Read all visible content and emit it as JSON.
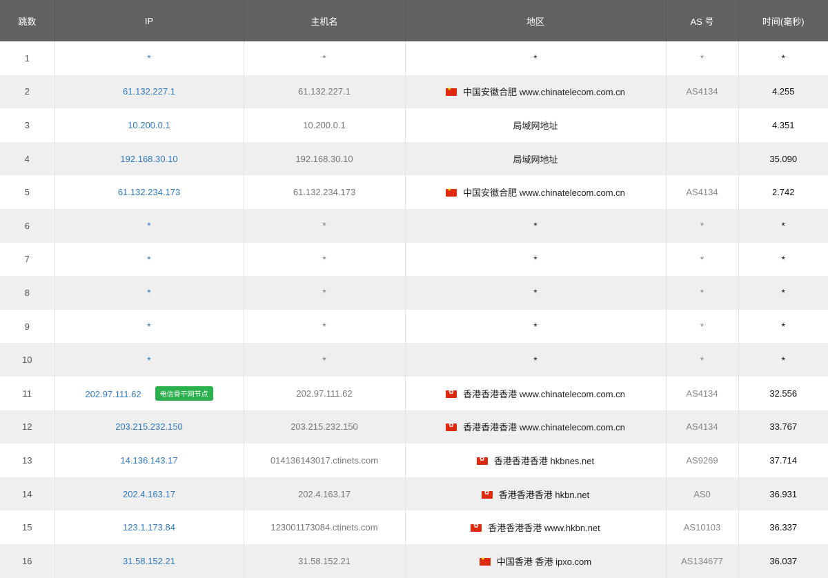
{
  "headers": [
    "跳数",
    "IP",
    "主机名",
    "地区",
    "AS 号",
    "时间(毫秒)"
  ],
  "rows": [
    {
      "hop": "1",
      "ip": "*",
      "host": "*",
      "region": "*",
      "flag": "",
      "asn": "*",
      "time": "*"
    },
    {
      "hop": "2",
      "ip": "61.132.227.1",
      "host": "61.132.227.1",
      "region": "中国安徽合肥 www.chinatelecom.com.cn",
      "flag": "cn-flag-icon",
      "asn": "AS4134",
      "time": "4.255"
    },
    {
      "hop": "3",
      "ip": "10.200.0.1",
      "host": "10.200.0.1",
      "region": "局域网地址",
      "flag": "",
      "asn": "",
      "time": "4.351"
    },
    {
      "hop": "4",
      "ip": "192.168.30.10",
      "host": "192.168.30.10",
      "region": "局域网地址",
      "flag": "",
      "asn": "",
      "time": "35.090"
    },
    {
      "hop": "5",
      "ip": "61.132.234.173",
      "host": "61.132.234.173",
      "region": "中国安徽合肥 www.chinatelecom.com.cn",
      "flag": "cn-flag-icon",
      "asn": "AS4134",
      "time": "2.742"
    },
    {
      "hop": "6",
      "ip": "*",
      "host": "*",
      "region": "*",
      "flag": "",
      "asn": "*",
      "time": "*"
    },
    {
      "hop": "7",
      "ip": "*",
      "host": "*",
      "region": "*",
      "flag": "",
      "asn": "*",
      "time": "*"
    },
    {
      "hop": "8",
      "ip": "*",
      "host": "*",
      "region": "*",
      "flag": "",
      "asn": "*",
      "time": "*"
    },
    {
      "hop": "9",
      "ip": "*",
      "host": "*",
      "region": "*",
      "flag": "",
      "asn": "*",
      "time": "*"
    },
    {
      "hop": "10",
      "ip": "*",
      "host": "*",
      "region": "*",
      "flag": "",
      "asn": "*",
      "time": "*"
    },
    {
      "hop": "11",
      "ip": "202.97.111.62",
      "badge": "电信骨干网节点",
      "host": "202.97.111.62",
      "region": "香港香港香港 www.chinatelecom.com.cn",
      "flag": "hk-flag-icon",
      "asn": "AS4134",
      "time": "32.556"
    },
    {
      "hop": "12",
      "ip": "203.215.232.150",
      "host": "203.215.232.150",
      "region": "香港香港香港 www.chinatelecom.com.cn",
      "flag": "hk-flag-icon",
      "asn": "AS4134",
      "time": "33.767"
    },
    {
      "hop": "13",
      "ip": "14.136.143.17",
      "host": "014136143017.ctinets.com",
      "region": "香港香港香港 hkbnes.net",
      "flag": "hk-flag-icon",
      "asn": "AS9269",
      "time": "37.714"
    },
    {
      "hop": "14",
      "ip": "202.4.163.17",
      "host": "202.4.163.17",
      "region": "香港香港香港 hkbn.net",
      "flag": "hk-flag-icon",
      "asn": "AS0",
      "time": "36.931"
    },
    {
      "hop": "15",
      "ip": "123.1.173.84",
      "host": "123001173084.ctinets.com",
      "region": "香港香港香港 www.hkbn.net",
      "flag": "hk-flag-icon",
      "asn": "AS10103",
      "time": "36.337"
    },
    {
      "hop": "16",
      "ip": "31.58.152.21",
      "host": "31.58.152.21",
      "region": "中国香港 香港 ipxo.com",
      "flag": "cn-flag-icon",
      "asn": "AS134677",
      "time": "36.037"
    }
  ],
  "colors": {
    "header_bg": "#626262",
    "ip_link": "#2f78c4",
    "badge_bg": "#2ab14d",
    "row_alt": "#efefef"
  }
}
